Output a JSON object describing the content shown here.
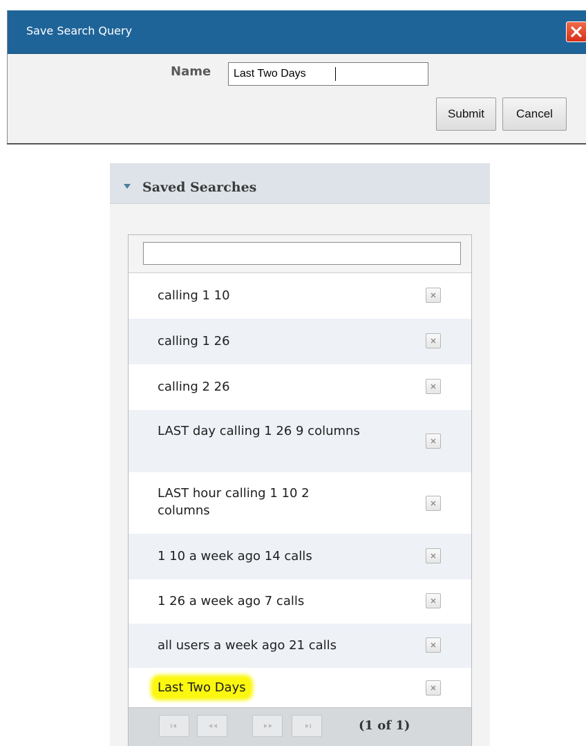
{
  "dialog": {
    "title": "Save Search Query",
    "name_label": "Name",
    "name_value": "Last Two Days",
    "submit_label": "Submit",
    "cancel_label": "Cancel"
  },
  "saved_searches": {
    "title": "Saved Searches",
    "filter_value": "",
    "items": [
      {
        "label": "calling 1 10"
      },
      {
        "label": "calling 1 26"
      },
      {
        "label": "calling 2 26"
      },
      {
        "label": "LAST day calling 1 26 9 columns"
      },
      {
        "label": "LAST hour calling 1 10 2 columns"
      },
      {
        "label": "1 10 a week ago 14 calls"
      },
      {
        "label": "1 26 a week ago 7 calls"
      },
      {
        "label": "all users a week ago 21 calls"
      },
      {
        "label": "Last Two Days"
      }
    ],
    "pager": {
      "text": "(1 of 1)",
      "buttons": [
        "first-page-icon",
        "prev-page-icon",
        "next-page-icon",
        "last-page-icon"
      ]
    }
  },
  "colors": {
    "titlebar": "#1f6499",
    "close_button": "#d8301a",
    "highlight": "#fbf70f",
    "panel_header": "#dde3e8"
  }
}
